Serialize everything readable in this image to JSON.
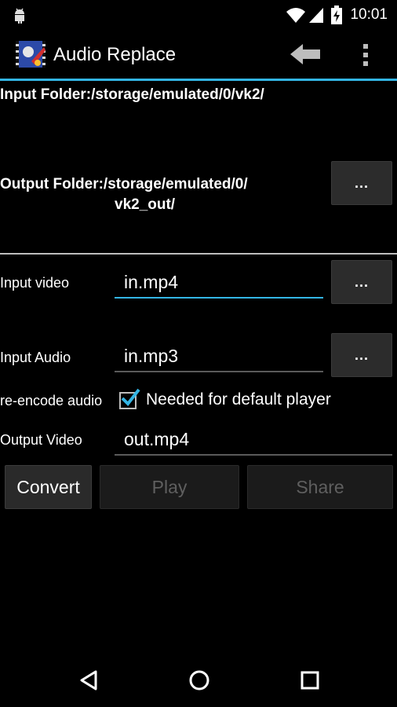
{
  "status_bar": {
    "time": "10:01",
    "icons": [
      "android-debug-icon",
      "wifi-icon",
      "cell-signal-icon",
      "battery-charging-icon"
    ]
  },
  "app_bar": {
    "title": "Audio Replace",
    "icons": [
      "app-logo-icon",
      "back-arrow-icon",
      "overflow-menu-icon"
    ]
  },
  "folders": {
    "input_label": "Input Folder:/storage/emulated/0/vk2/",
    "output_label_line1": "Output Folder:/storage/emulated/0/",
    "output_label_line2": "vk2_out/",
    "browse_label": "..."
  },
  "form": {
    "input_video_label": "Input video",
    "input_video_value": "in.mp4",
    "input_audio_label": "Input Audio",
    "input_audio_value": "in.mp3",
    "reencode_label": "re-encode audio",
    "reencode_checked": true,
    "reencode_hint": "Needed for default player",
    "output_video_label": "Output Video",
    "output_video_value": "out.mp4",
    "browse_label": "..."
  },
  "actions": {
    "convert": "Convert",
    "play": "Play",
    "share": "Share"
  },
  "nav_bar": {
    "icons": [
      "nav-back-icon",
      "nav-home-icon",
      "nav-recents-icon"
    ]
  },
  "colors": {
    "accent": "#33b5e5",
    "background": "#000000",
    "disabled_text": "#5f5f5f"
  }
}
